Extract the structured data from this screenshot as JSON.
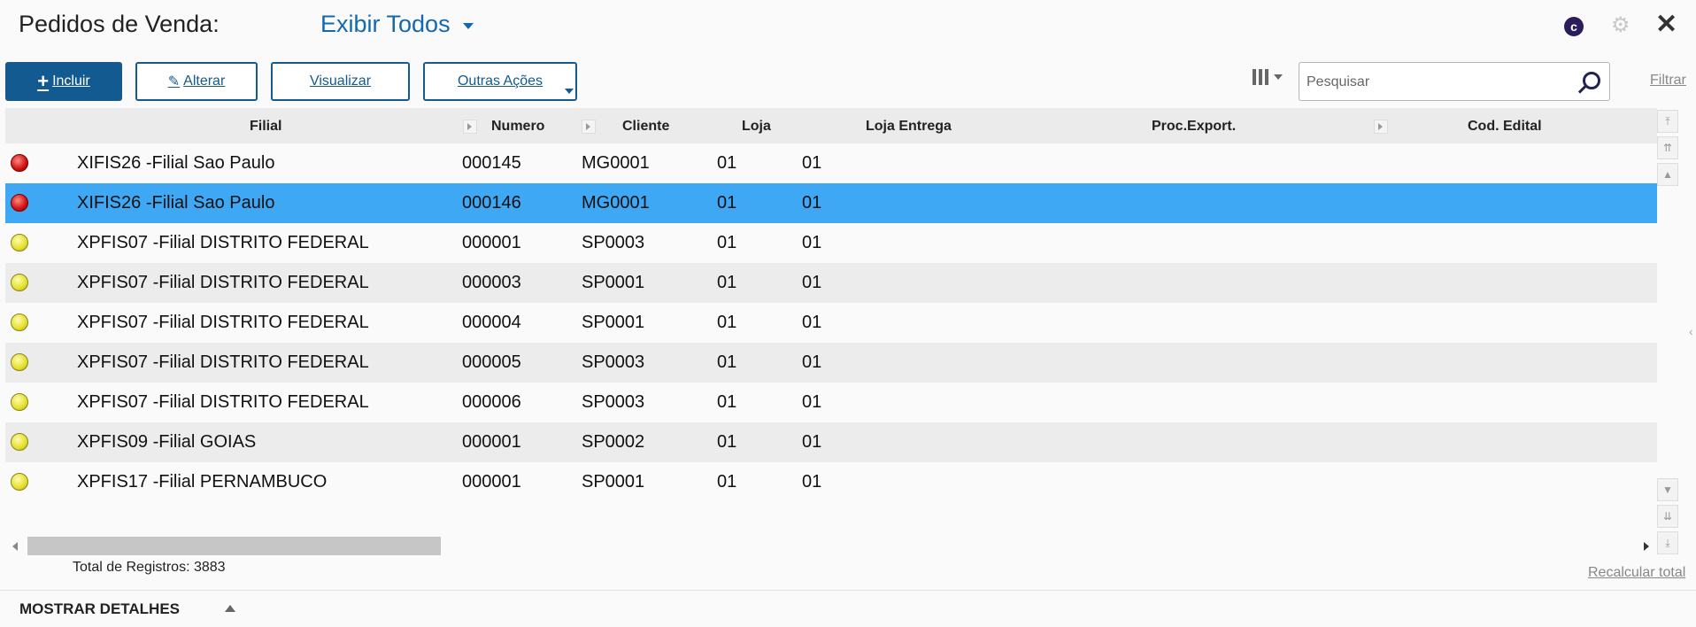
{
  "header": {
    "title": "Pedidos de Venda:",
    "view_label": "Exibir Todos",
    "logo_letter": "c"
  },
  "toolbar": {
    "incluir": "Incluir",
    "alterar": "Alterar",
    "visualizar": "Visualizar",
    "outras_acoes": "Outras Ações",
    "search_placeholder": "Pesquisar",
    "filtrar": "Filtrar"
  },
  "grid": {
    "columns": [
      "Filial",
      "Numero",
      "Cliente",
      "Loja",
      "Loja Entrega",
      "Proc.Export.",
      "Cod. Edital"
    ],
    "rows": [
      {
        "status": "red",
        "filial": "XIFIS26 -Filial Sao Paulo",
        "numero": "000145",
        "cliente": "MG0001",
        "loja": "01",
        "loja_entrega": "01"
      },
      {
        "status": "red",
        "filial": "XIFIS26 -Filial Sao Paulo",
        "numero": "000146",
        "cliente": "MG0001",
        "loja": "01",
        "loja_entrega": "01"
      },
      {
        "status": "yellow",
        "filial": "XPFIS07 -Filial DISTRITO FEDERAL",
        "numero": "000001",
        "cliente": "SP0003",
        "loja": "01",
        "loja_entrega": "01"
      },
      {
        "status": "yellow",
        "filial": "XPFIS07 -Filial DISTRITO FEDERAL",
        "numero": "000003",
        "cliente": "SP0001",
        "loja": "01",
        "loja_entrega": "01"
      },
      {
        "status": "yellow",
        "filial": "XPFIS07 -Filial DISTRITO FEDERAL",
        "numero": "000004",
        "cliente": "SP0001",
        "loja": "01",
        "loja_entrega": "01"
      },
      {
        "status": "yellow",
        "filial": "XPFIS07 -Filial DISTRITO FEDERAL",
        "numero": "000005",
        "cliente": "SP0003",
        "loja": "01",
        "loja_entrega": "01"
      },
      {
        "status": "yellow",
        "filial": "XPFIS07 -Filial DISTRITO FEDERAL",
        "numero": "000006",
        "cliente": "SP0003",
        "loja": "01",
        "loja_entrega": "01"
      },
      {
        "status": "yellow",
        "filial": "XPFIS09 -Filial GOIAS",
        "numero": "000001",
        "cliente": "SP0002",
        "loja": "01",
        "loja_entrega": "01"
      },
      {
        "status": "yellow",
        "filial": "XPFIS17 -Filial PERNAMBUCO",
        "numero": "000001",
        "cliente": "SP0001",
        "loja": "01",
        "loja_entrega": "01"
      }
    ],
    "selected_row": 1,
    "total_label": "Total de Registros: 3883",
    "recalc_label": "Recalcular total"
  },
  "footer": {
    "details_label": "MOSTRAR DETALHES"
  },
  "colors": {
    "primary": "#135a90",
    "link": "#1468b0",
    "selected_row": "#3ea8f5",
    "alt_row": "#ececec"
  }
}
